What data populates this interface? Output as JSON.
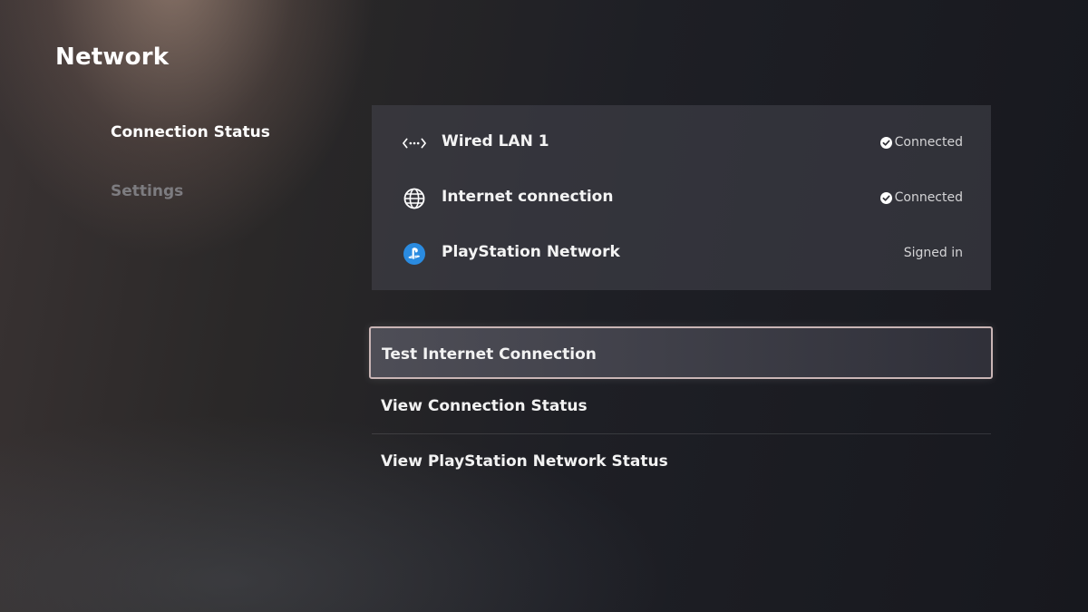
{
  "page": {
    "title": "Network"
  },
  "sidebar": {
    "items": [
      {
        "label": "Connection Status",
        "active": true
      },
      {
        "label": "Settings",
        "active": false
      }
    ]
  },
  "status": {
    "rows": [
      {
        "icon": "wired-lan-icon",
        "label": "Wired LAN 1",
        "value": "Connected",
        "check": true
      },
      {
        "icon": "globe-icon",
        "label": "Internet connection",
        "value": "Connected",
        "check": true
      },
      {
        "icon": "playstation-network-icon",
        "label": "PlayStation Network",
        "value": "Signed in",
        "check": false
      }
    ]
  },
  "actions": {
    "items": [
      {
        "label": "Test Internet Connection",
        "focused": true
      },
      {
        "label": "View Connection Status",
        "focused": false
      },
      {
        "label": "View PlayStation Network Status",
        "focused": false
      }
    ]
  },
  "colors": {
    "accent_focus_border": "#c9b5b5",
    "psn_blue": "#2a8be0",
    "inactive_text": "#7d7c80"
  }
}
